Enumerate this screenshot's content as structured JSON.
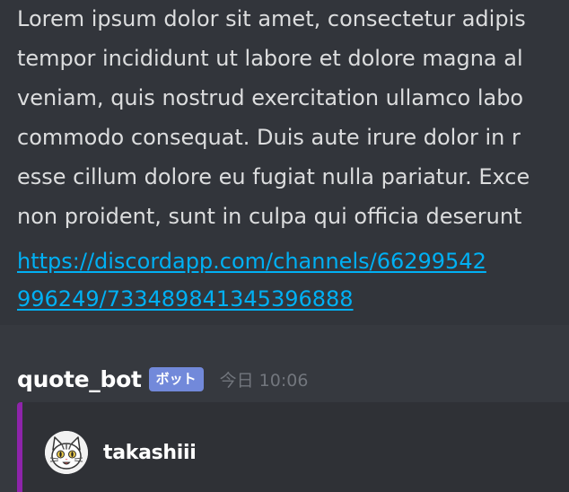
{
  "message_top": {
    "lines": [
      "Lorem ipsum dolor sit amet, consectetur adipis",
      "tempor incididunt ut labore et dolore magna al",
      "veniam, quis nostrud exercitation ullamco labo",
      "commodo consequat. Duis aute irure dolor in r",
      "esse cillum dolore eu fugiat nulla pariatur. Exce",
      "non proident, sunt in culpa qui officia deserunt"
    ],
    "link_lines": [
      "https://discordapp.com/channels/66299542",
      "996249/733489841345396888"
    ]
  },
  "message": {
    "username": "quote_bot",
    "badge": "ボット",
    "timestamp": "今日 10:06",
    "embed": {
      "author_name": "takashiii",
      "accent_color": "#8e24aa",
      "avatar_icon": "cat-avatar-icon"
    }
  },
  "colors": {
    "background": "#36393f",
    "text": "#dcddde",
    "link": "#00b0f4",
    "badge": "#7289da",
    "timestamp": "#72767d",
    "embed_bg": "#2f3136"
  }
}
